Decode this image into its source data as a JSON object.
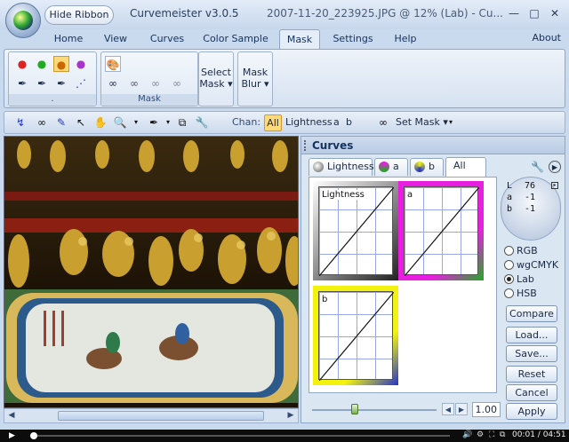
{
  "window": {
    "hide_ribbon_label": "Hide Ribbon",
    "app_title": "Curvemeister v3.0.5",
    "file_title": "2007-11-20_223925.JPG @ 12% (Lab) - Cu...",
    "min": "—",
    "max": "□",
    "close": "✕"
  },
  "menu_tabs": [
    {
      "label": "Home"
    },
    {
      "label": "View"
    },
    {
      "label": "Curves"
    },
    {
      "label": "Color Sample"
    },
    {
      "label": "Mask"
    },
    {
      "label": "Settings"
    },
    {
      "label": "Help"
    }
  ],
  "active_tab": "Mask",
  "about_label": "About",
  "ribbon": {
    "group1_label": ".",
    "group2_label": "Mask",
    "select_mask_line1": "Select",
    "select_mask_line2": "Mask ▾",
    "mask_blur_line1": "Mask",
    "mask_blur_line2": "Blur ▾"
  },
  "toolbar": {
    "chan_label": "Chan:",
    "chan_all": "All",
    "chan_lightness": "Lightness",
    "chan_a": "a",
    "chan_b": "b",
    "set_mask": "Set Mask ▾"
  },
  "curves": {
    "title": "Curves",
    "tabs": [
      {
        "label": "Lightness"
      },
      {
        "label": "a"
      },
      {
        "label": "b"
      },
      {
        "label": "All"
      }
    ],
    "active_tab": "All",
    "graph_labels": {
      "lightness": "Lightness",
      "a": "a",
      "b": "b"
    },
    "zoom_value": "1.00"
  },
  "readout": {
    "L": "76",
    "a": "-1",
    "b": "-1",
    "L_key": "L",
    "a_key": "a",
    "b_key": "b"
  },
  "color_modes": [
    {
      "label": "RGB",
      "selected": false
    },
    {
      "label": "wgCMYK",
      "selected": false
    },
    {
      "label": "Lab",
      "selected": true
    },
    {
      "label": "HSB",
      "selected": false
    }
  ],
  "buttons": {
    "compare": "Compare",
    "load": "Load...",
    "save": "Save...",
    "reset": "Reset",
    "cancel": "Cancel",
    "apply": "Apply"
  },
  "video": {
    "time": "00:01 / 04:51",
    "progress": 0.004
  },
  "colors": {
    "accent": "#ffd97a",
    "magenta": "#e81ee0",
    "yellow": "#f2f20e"
  }
}
